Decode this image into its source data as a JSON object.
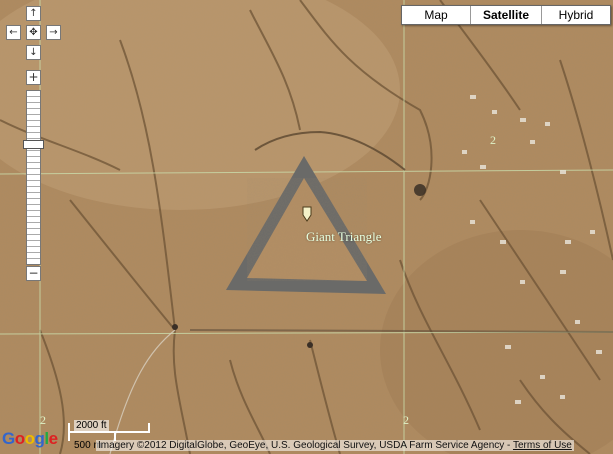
{
  "map_type_control": {
    "buttons": [
      {
        "label": "Map",
        "active": false
      },
      {
        "label": "Satellite",
        "active": true
      },
      {
        "label": "Hybrid",
        "active": false
      }
    ]
  },
  "pan_control": {
    "up": "↑",
    "down": "↓",
    "left": "←",
    "right": "→",
    "center": "✥"
  },
  "zoom_control": {
    "plus": "+",
    "minus": "−"
  },
  "marker": {
    "label": "Giant Triangle"
  },
  "grid_labels": [
    "2",
    "2",
    "2"
  ],
  "scale": {
    "feet": "2000 ft",
    "meters": "500 m"
  },
  "attribution": {
    "text": "Imagery ©2012 DigitalGlobe, GeoEye, U.S. Geological Survey, USDA Farm Service Agency - ",
    "terms_link": "Terms of Use"
  },
  "logo": {
    "text": "Google",
    "colors": [
      "#3366cc",
      "#dd2222",
      "#eebb00",
      "#3366cc",
      "#22aa44",
      "#dd2222"
    ]
  },
  "colors": {
    "desert": "#b08a5e",
    "triangle": "#6a6a68",
    "grid_line": "#c9d9a8"
  }
}
